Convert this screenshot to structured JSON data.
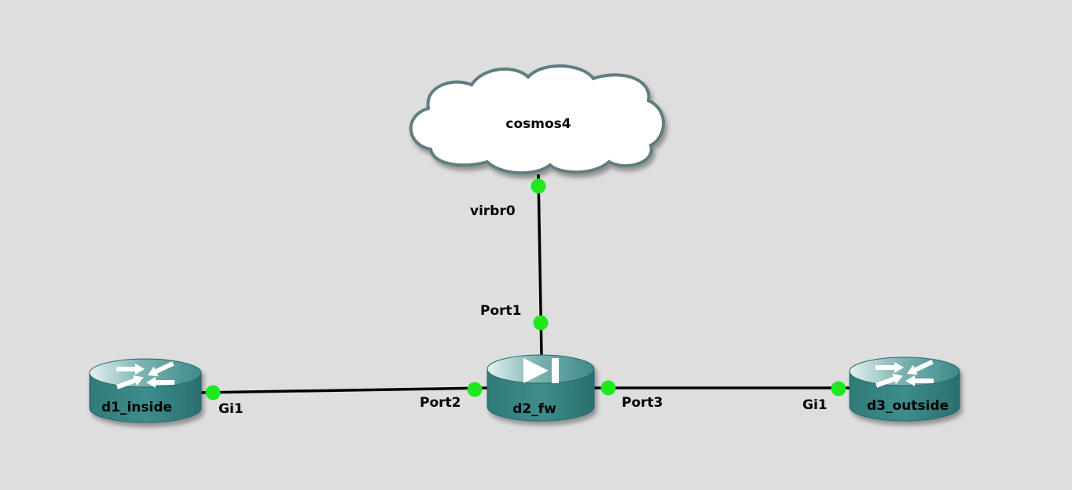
{
  "diagram": {
    "nodes": [
      {
        "id": "cosmos4",
        "label": "cosmos4",
        "type": "cloud"
      },
      {
        "id": "d1_inside",
        "label": "d1_inside",
        "type": "router"
      },
      {
        "id": "d2_fw",
        "label": "d2_fw",
        "type": "firewall"
      },
      {
        "id": "d3_outside",
        "label": "d3_outside",
        "type": "router"
      }
    ],
    "links": [
      {
        "from": "cosmos4",
        "from_port": "virbr0",
        "to": "d2_fw",
        "to_port": "Port1"
      },
      {
        "from": "d1_inside",
        "from_port": "Gi1",
        "to": "d2_fw",
        "to_port": "Port2"
      },
      {
        "from": "d2_fw",
        "from_port": "Port3",
        "to": "d3_outside",
        "to_port": "Gi1"
      }
    ],
    "port_status_color": "#1fe81f",
    "device_color": "#3b8a89",
    "cloud_outline_color": "#5e7e80"
  }
}
